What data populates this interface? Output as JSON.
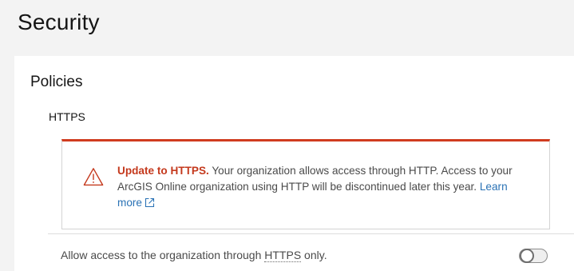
{
  "page": {
    "title": "Security"
  },
  "policies": {
    "title": "Policies",
    "https_heading": "HTTPS"
  },
  "alert": {
    "icon": "warning-triangle-icon",
    "title": "Update to HTTPS.",
    "message": " Your organization allows access through HTTP. Access to your ArcGIS Online organization using HTTP will be discontinued later this year. ",
    "link_label": "Learn more",
    "link_icon": "external-link-icon",
    "accent_color": "#d03c1f",
    "title_color": "#c4391d",
    "link_color": "#2a72b5"
  },
  "setting": {
    "label_prefix": "Allow access to the organization through ",
    "label_term": "HTTPS",
    "label_suffix": " only.",
    "enabled": false
  }
}
